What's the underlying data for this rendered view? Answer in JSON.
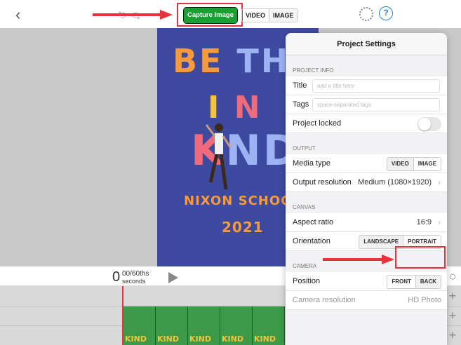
{
  "toolbar": {
    "capture_label": "Capture Image",
    "mode_video": "VIDEO",
    "mode_image": "IMAGE"
  },
  "poster": {
    "line1_a": "BE",
    "line1_b": "TH",
    "line2_a": "I",
    "line2_b": "N",
    "line3_a": "K",
    "line3_b": "ND",
    "line4": "NIXON SCHOOL",
    "line5": "2021"
  },
  "time": {
    "big": "0",
    "fraction": "00/60ths",
    "unit": "seconds"
  },
  "clip_frame_text": [
    "KIND",
    "KIND",
    "KIND",
    "KIND",
    "KIND"
  ],
  "settings": {
    "title": "Project Settings",
    "project_info_header": "PROJECT INFO",
    "title_label": "Title",
    "title_placeholder": "add a title here",
    "tags_label": "Tags",
    "tags_placeholder": "space-separated tags",
    "locked_label": "Project locked",
    "output_header": "OUTPUT",
    "media_type_label": "Media type",
    "media_video": "VIDEO",
    "media_image": "IMAGE",
    "resolution_label": "Output resolution",
    "resolution_value": "Medium (1080×1920)",
    "canvas_header": "CANVAS",
    "aspect_label": "Aspect ratio",
    "aspect_value": "16:9",
    "orientation_label": "Orientation",
    "landscape": "LANDSCAPE",
    "portrait": "PORTRAIT",
    "camera_header": "CAMERA",
    "position_label": "Position",
    "front": "FRONT",
    "back": "BACK",
    "camera_res_label": "Camera resolution",
    "camera_res_value": "HD Photo"
  },
  "colors": {
    "capture_green": "#1aa032",
    "annotation_red": "#e8333c",
    "poster_blue": "#3e4a9f"
  }
}
